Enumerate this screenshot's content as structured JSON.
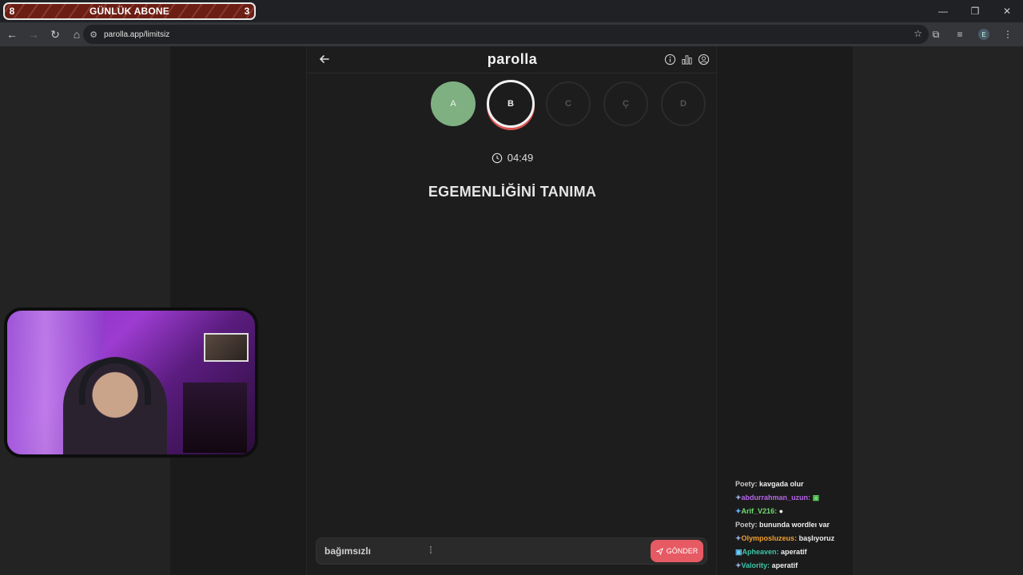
{
  "subscriber_banner": {
    "left_count": "8",
    "title": "GÜNLÜK ABONE",
    "right_count": "3"
  },
  "browser": {
    "url": "parolla.app/limitsiz",
    "profile_initial": "E"
  },
  "app": {
    "logo": "parolla"
  },
  "letters": [
    {
      "label": "A",
      "state": "done"
    },
    {
      "label": "B",
      "state": "active"
    },
    {
      "label": "C",
      "state": "pending"
    },
    {
      "label": "Ç",
      "state": "pending"
    },
    {
      "label": "D",
      "state": "pending"
    }
  ],
  "timer": "04:49",
  "question": "EGEMENLİĞİNİ TANIMA",
  "answer_input": {
    "value": "bağımsızlı"
  },
  "send_button": "GÖNDER",
  "chat": [
    {
      "user": "Poety:",
      "message": "kavgada olur",
      "color": "#c8c8c8"
    },
    {
      "user": "abdurrahman_uzun:",
      "message": "",
      "color": "#b565e8"
    },
    {
      "user": "Arif_V216:",
      "message": "",
      "color": "#6fdc6f"
    },
    {
      "user": "Poety:",
      "message": "bununda wordleı var",
      "color": "#c8c8c8"
    },
    {
      "user": "Olymposluzeus:",
      "message": "başlıyoruz",
      "color": "#f0a030"
    },
    {
      "user": "Apheaven:",
      "message": "aperatif",
      "color": "#3ec6a8"
    },
    {
      "user": "Valority:",
      "message": "aperatif",
      "color": "#3ec6a8"
    }
  ],
  "colors": {
    "accent": "#e65a64",
    "done_green": "#7fb082",
    "active_underline": "#d9534f"
  }
}
